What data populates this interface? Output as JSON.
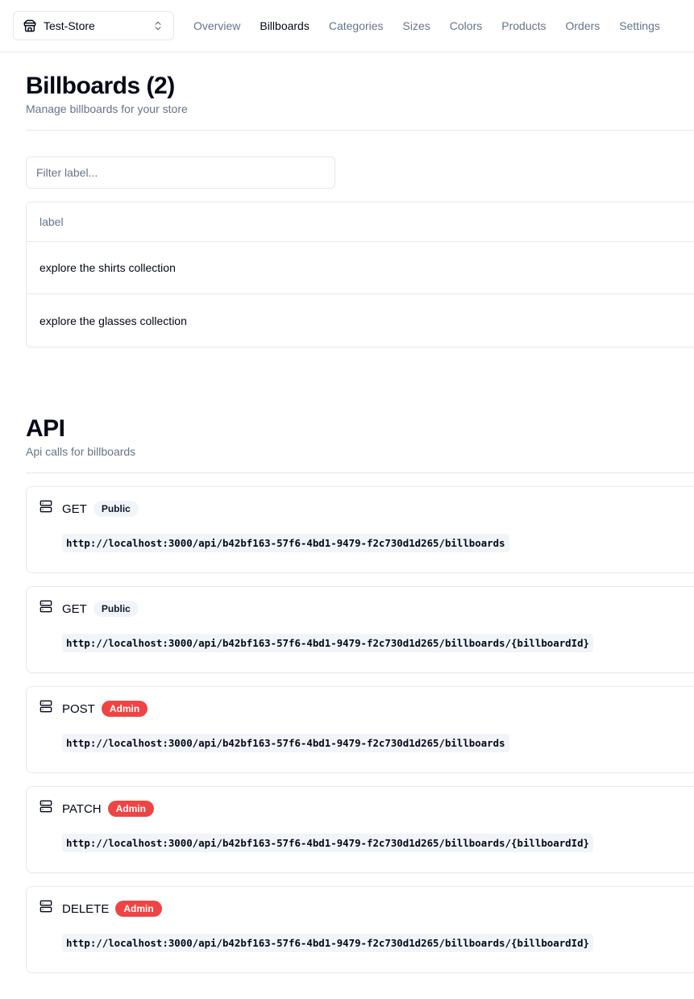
{
  "store_switcher": {
    "name": "Test-Store",
    "icon": "store-icon"
  },
  "nav": {
    "items": [
      {
        "label": "Overview",
        "active": false
      },
      {
        "label": "Billboards",
        "active": true
      },
      {
        "label": "Categories",
        "active": false
      },
      {
        "label": "Sizes",
        "active": false
      },
      {
        "label": "Colors",
        "active": false
      },
      {
        "label": "Products",
        "active": false
      },
      {
        "label": "Orders",
        "active": false
      },
      {
        "label": "Settings",
        "active": false
      }
    ]
  },
  "billboards": {
    "title": "Billboards (2)",
    "description": "Manage billboards for your store",
    "filter": {
      "placeholder": "Filter label...",
      "value": ""
    },
    "table": {
      "columns": [
        "label"
      ],
      "rows": [
        {
          "label": "explore the shirts collection"
        },
        {
          "label": "explore the glasses collection"
        }
      ]
    }
  },
  "api": {
    "title": "API",
    "description": "Api calls for billboards",
    "endpoints": [
      {
        "method": "GET",
        "access": "Public",
        "variant": "public",
        "url": "http://localhost:3000/api/b42bf163-57f6-4bd1-9479-f2c730d1d265/billboards"
      },
      {
        "method": "GET",
        "access": "Public",
        "variant": "public",
        "url": "http://localhost:3000/api/b42bf163-57f6-4bd1-9479-f2c730d1d265/billboards/{billboardId}"
      },
      {
        "method": "POST",
        "access": "Admin",
        "variant": "admin",
        "url": "http://localhost:3000/api/b42bf163-57f6-4bd1-9479-f2c730d1d265/billboards"
      },
      {
        "method": "PATCH",
        "access": "Admin",
        "variant": "admin",
        "url": "http://localhost:3000/api/b42bf163-57f6-4bd1-9479-f2c730d1d265/billboards/{billboardId}"
      },
      {
        "method": "DELETE",
        "access": "Admin",
        "variant": "admin",
        "url": "http://localhost:3000/api/b42bf163-57f6-4bd1-9479-f2c730d1d265/billboards/{billboardId}"
      }
    ]
  },
  "colors": {
    "admin_badge": "#ef4444",
    "public_badge": "#f1f5f9",
    "muted_text": "#64748b",
    "border": "#e2e8f0"
  }
}
